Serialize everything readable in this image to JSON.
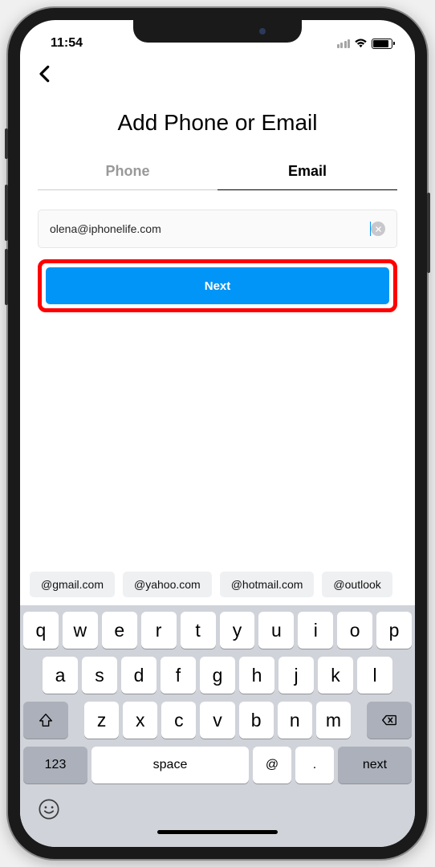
{
  "status_bar": {
    "time": "11:54"
  },
  "page": {
    "title": "Add Phone or Email"
  },
  "tabs": {
    "phone": "Phone",
    "email": "Email"
  },
  "input": {
    "value": "olena@iphonelife.com"
  },
  "buttons": {
    "next": "Next"
  },
  "suggestions": [
    "@gmail.com",
    "@yahoo.com",
    "@hotmail.com",
    "@outlook"
  ],
  "keyboard": {
    "row1": [
      "q",
      "w",
      "e",
      "r",
      "t",
      "y",
      "u",
      "i",
      "o",
      "p"
    ],
    "row2": [
      "a",
      "s",
      "d",
      "f",
      "g",
      "h",
      "j",
      "k",
      "l"
    ],
    "row3": [
      "z",
      "x",
      "c",
      "v",
      "b",
      "n",
      "m"
    ],
    "fn": {
      "numbers": "123",
      "space": "space",
      "at": "@",
      "dot": ".",
      "next": "next"
    }
  }
}
